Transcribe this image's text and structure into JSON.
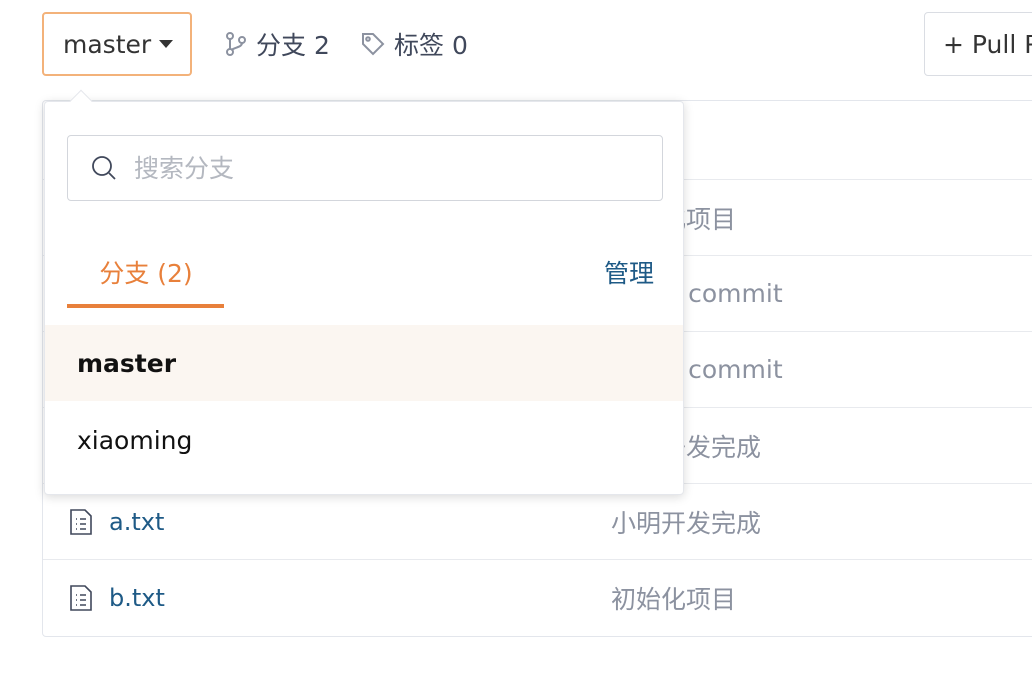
{
  "toolbar": {
    "current_branch": "master",
    "branch_count_label": "分支 2",
    "tag_count_label": "标签 0",
    "pull_request_label": "+ Pull R"
  },
  "files": [
    {
      "name": "",
      "message": "初始化项目"
    },
    {
      "name": "",
      "message": "Initial commit"
    },
    {
      "name": "",
      "message": "Initial commit"
    },
    {
      "name": "",
      "message": "小明开发完成"
    },
    {
      "name": "a.txt",
      "message": "小明开发完成"
    },
    {
      "name": "b.txt",
      "message": "初始化项目"
    }
  ],
  "dropdown": {
    "search_placeholder": "搜索分支",
    "tab_label": "分支 (2)",
    "manage_label": "管理",
    "branches": [
      {
        "name": "master",
        "active": true
      },
      {
        "name": "xiaoming",
        "active": false
      }
    ]
  },
  "colors": {
    "accent": "#e8803b",
    "link": "#1e5a86",
    "active_row_bg": "#fbf6f1"
  }
}
